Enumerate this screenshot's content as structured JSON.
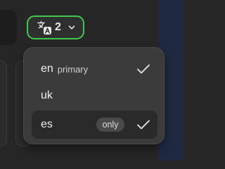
{
  "language_button": {
    "icon": "translate-icon",
    "count": "2",
    "chevron": "chevron-down-icon",
    "border_color": "#3fc94d"
  },
  "dropdown": {
    "items": [
      {
        "code": "en",
        "tag": "primary",
        "checked": true
      },
      {
        "code": "uk",
        "checked": false
      },
      {
        "code": "es",
        "badge": "only",
        "checked": true,
        "highlighted": true
      }
    ]
  }
}
